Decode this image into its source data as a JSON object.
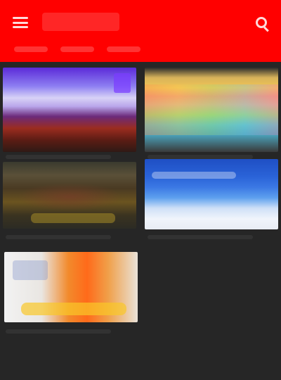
{
  "header": {
    "background_color": "#ff0000",
    "menu_icon": "menu-icon",
    "search_icon": "search-icon"
  },
  "videos": [
    {
      "thumbnail_colors": [
        "#5b2ad8",
        "#d8d2f6",
        "#9b2c1f"
      ]
    },
    {
      "thumbnail_colors": [
        "#f0c455",
        "#9ad37a",
        "#4aa0b8"
      ]
    },
    {
      "thumbnail_colors": [
        "#4a3a22",
        "#6b5420",
        "#2c2b24"
      ]
    },
    {
      "thumbnail_colors": [
        "#1f4fc4",
        "#5da0ee",
        "#f0f4fb"
      ]
    },
    {
      "thumbnail_colors": [
        "#f2f2f2",
        "#ff6a1a",
        "#fac828"
      ]
    }
  ],
  "theme": {
    "page_background": "#262626"
  }
}
